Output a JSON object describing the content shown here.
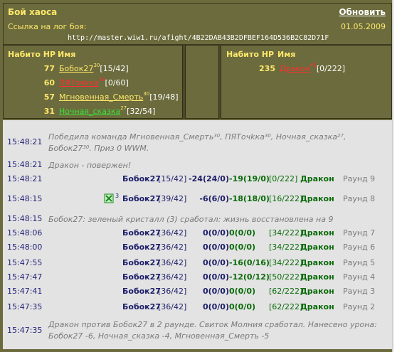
{
  "header": {
    "title": "Бой хаоса",
    "refresh_label": "Обновить",
    "log_link_label": "Ссылка на лог боя:",
    "date": "01.05.2009",
    "url": "http://master.wiw1.ru/afight/4B22DAB43B2DFBEF164D536B2C82D71F"
  },
  "team_headers": {
    "hp": "Набито HP",
    "name": "Имя"
  },
  "team_left": [
    {
      "hp": "77",
      "name": "Бобок27",
      "level": "30",
      "stat": "[15/42]",
      "color": "#ffe86a"
    },
    {
      "hp": "60",
      "name": "ПЯТочkка",
      "level": "30",
      "stat": "[0/60]",
      "color": "#ff3030"
    },
    {
      "hp": "57",
      "name": "Мгновенная_Смерть",
      "level": "30",
      "stat": "[19/48]",
      "color": "#ffe86a"
    },
    {
      "hp": "31",
      "name": "Ночная_сказка",
      "level": "27",
      "stat": "[32/54]",
      "color": "#3ae13a"
    }
  ],
  "team_right": [
    {
      "hp": "235",
      "name": "Дракон",
      "level": "45",
      "stat": "[0/222]",
      "color": "#ff3030"
    }
  ],
  "log": {
    "victory": {
      "time": "15:48:21",
      "line1_a": "Победила команда Мгновенная_Смерть",
      "lvl1": "30",
      "line1_b": ", ПЯТочkка",
      "lvl2": "30",
      "line1_c": ", Ночная_сказка",
      "lvl3": "27",
      "line1_d": ",",
      "line2_a": "Бобок27",
      "lvl4": "30",
      "line2_b": ". Приз 0 WWM."
    },
    "defeated": {
      "time": "15:48:21",
      "text": "Дракон - повержен!"
    },
    "crystal": {
      "time": "15:48:15",
      "text": "Бобок27: зеленый кристалл (3) сработал: жизнь восстановлена на 9"
    },
    "final_event": {
      "time": "15:47:35",
      "line1": "Дракон против Бобок27 в 2 раунде. Свиток Молния сработал. Нанесено урона:",
      "line2": "Бобок27 -6, Ночная_сказка -4, Мгновенная_Смерть -5"
    },
    "rounds": [
      {
        "time": "15:48:21",
        "attacker": "Бобок27",
        "a_stat": "[15/42]",
        "dmg1": "-24(24/0)",
        "dmg2": "-19(19/0)",
        "d_stat": "[0/222]",
        "defender": "Дракон",
        "round": "Раунд 9",
        "icon": false
      },
      {
        "time": "15:48:15",
        "attacker": "Бобок27",
        "a_stat": "[39/42]",
        "dmg1": "-6(6/0)",
        "dmg2": "-18(18/0)",
        "d_stat": "[16/222]",
        "defender": "Дракон",
        "round": "Раунд 8",
        "icon": true,
        "icon_count": "3"
      },
      {
        "time": "15:48:06",
        "attacker": "Бобок27",
        "a_stat": "[36/42]",
        "dmg1": "0(0/0)",
        "dmg2": "0(0/0)",
        "d_stat": "[34/222]",
        "defender": "Дракон",
        "round": "Раунд 7",
        "icon": false
      },
      {
        "time": "15:48:00",
        "attacker": "Бобок27",
        "a_stat": "[36/42]",
        "dmg1": "0(0/0)",
        "dmg2": "0(0/0)",
        "d_stat": "[34/222]",
        "defender": "Дракон",
        "round": "Раунд 6",
        "icon": false
      },
      {
        "time": "15:47:55",
        "attacker": "Бобок27",
        "a_stat": "[36/42]",
        "dmg1": "0(0/0)",
        "dmg2": "-16(0/16)",
        "d_stat": "[34/222]",
        "defender": "Дракон",
        "round": "Раунд 5",
        "icon": false
      },
      {
        "time": "15:47:47",
        "attacker": "Бобок27",
        "a_stat": "[36/42]",
        "dmg1": "0(0/0)",
        "dmg2": "-12(0/12)",
        "d_stat": "[50/222]",
        "defender": "Дракон",
        "round": "Раунд 4",
        "icon": false
      },
      {
        "time": "15:47:41",
        "attacker": "Бобок27",
        "a_stat": "[36/42]",
        "dmg1": "0(0/0)",
        "dmg2": "0(0/0)",
        "d_stat": "[62/222]",
        "defender": "Дракон",
        "round": "Раунд 3",
        "icon": false
      },
      {
        "time": "15:47:35",
        "attacker": "Бобок27",
        "a_stat": "[36/42]",
        "dmg1": "0(0/0)",
        "dmg2": "0(0/0)",
        "d_stat": "[62/222]",
        "defender": "Дракон",
        "round": "Раунд 2",
        "icon": false
      }
    ]
  }
}
